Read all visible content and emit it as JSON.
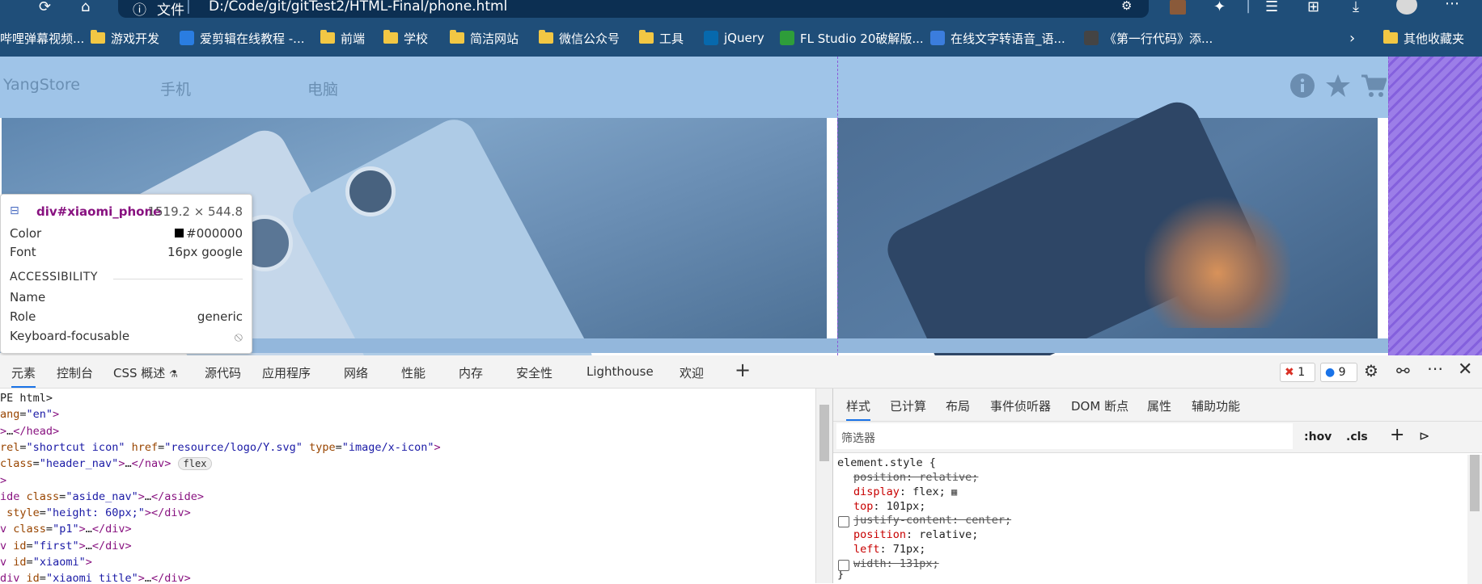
{
  "browser": {
    "address_prefix": "文件",
    "address_path": "D:/Code/git/gitTest2/HTML-Final/phone.html",
    "bookmarks": [
      {
        "label": "哔哩弹幕视频...",
        "kind": "site",
        "color": "#fb7299"
      },
      {
        "label": "游戏开发",
        "kind": "folder"
      },
      {
        "label": "爱剪辑在线教程 -...",
        "kind": "site",
        "color": "#2a7de1"
      },
      {
        "label": "前端",
        "kind": "folder"
      },
      {
        "label": "学校",
        "kind": "folder"
      },
      {
        "label": "简洁网站",
        "kind": "folder"
      },
      {
        "label": "微信公众号",
        "kind": "folder"
      },
      {
        "label": "工具",
        "kind": "folder"
      },
      {
        "label": "jQuery",
        "kind": "site",
        "color": "#0769ad"
      },
      {
        "label": "FL Studio 20破解版...",
        "kind": "site",
        "color": "#2e9d3a"
      },
      {
        "label": "在线文字转语音_语...",
        "kind": "site",
        "color": "#3b7ddd"
      },
      {
        "label": "《第一行代码》添...",
        "kind": "site",
        "color": "#444444"
      }
    ],
    "bookmarks_other": "其他收藏夹"
  },
  "page": {
    "brand": "YangStore",
    "nav_items": [
      "手机",
      "电脑"
    ],
    "header_icons": [
      "info-icon",
      "star-icon",
      "cart-icon",
      "user-icon"
    ]
  },
  "inspect_tooltip": {
    "selector": "div#xiaomi_phone",
    "size": "1519.2 × 544.8",
    "color_label": "Color",
    "color_value": "#000000",
    "font_label": "Font",
    "font_value": "16px google",
    "section": "ACCESSIBILITY",
    "name_label": "Name",
    "role_label": "Role",
    "role_value": "generic",
    "focus_label": "Keyboard-focusable"
  },
  "devtools": {
    "tabs": [
      "元素",
      "控制台",
      "CSS 概述",
      "源代码",
      "应用程序",
      "网络",
      "性能",
      "内存",
      "安全性",
      "Lighthouse",
      "欢迎"
    ],
    "errors": "1",
    "messages": "9",
    "code_lines": [
      {
        "html": "<span class='plain'>PE html&gt;</span>"
      },
      {
        "html": "<span class='attr'>ang</span><span class='plain'>=</span><span class='aval'>\"en\"</span><span class='tag'>&gt;</span>"
      },
      {
        "html": "<span class='tag'>&gt;</span><span class='plain'>…</span><span class='tag'>&lt;/head&gt;</span>"
      },
      {
        "html": "<span class='attr'>rel</span><span class='plain'>=</span><span class='aval'>\"shortcut icon\"</span> <span class='attr'>href</span><span class='plain'>=</span><span class='aval'>\"resource/logo/Y.svg\"</span> <span class='attr'>type</span><span class='plain'>=</span><span class='aval'>\"image/x-icon\"</span><span class='tag'>&gt;</span>"
      },
      {
        "html": "<span class='attr'>class</span><span class='plain'>=</span><span class='aval'>\"header_nav\"</span><span class='tag'>&gt;</span><span class='plain'>…</span><span class='tag'>&lt;/nav&gt;</span> <span class='badge'>flex</span>"
      },
      {
        "html": "<span class='tag'>&gt;</span>"
      },
      {
        "html": "<span class='tag'>ide</span> <span class='attr'>class</span><span class='plain'>=</span><span class='aval'>\"aside_nav\"</span><span class='tag'>&gt;</span><span class='plain'>…</span><span class='tag'>&lt;/aside&gt;</span>"
      },
      {
        "html": " <span class='attr'>style</span><span class='plain'>=</span><span class='aval'>\"height: 60px;\"</span><span class='tag'>&gt;&lt;/div&gt;</span>"
      },
      {
        "html": "<span class='tag'>v</span> <span class='attr'>class</span><span class='plain'>=</span><span class='aval'>\"p1\"</span><span class='tag'>&gt;</span><span class='plain'>…</span><span class='tag'>&lt;/div&gt;</span>"
      },
      {
        "html": "<span class='tag'>v</span> <span class='attr'>id</span><span class='plain'>=</span><span class='aval'>\"first\"</span><span class='tag'>&gt;</span><span class='plain'>…</span><span class='tag'>&lt;/div&gt;</span>"
      },
      {
        "html": "<span class='tag'>v</span> <span class='attr'>id</span><span class='plain'>=</span><span class='aval'>\"xiaomi\"</span><span class='tag'>&gt;</span>"
      },
      {
        "html": "<span class='tag'>div</span> <span class='attr'>id</span><span class='plain'>=</span><span class='aval'>\"xiaomi_title\"</span><span class='tag'>&gt;</span><span class='plain'>…</span><span class='tag'>&lt;/div&gt;</span>"
      }
    ]
  },
  "styles_panel": {
    "tabs": [
      "样式",
      "已计算",
      "布局",
      "事件侦听器",
      "DOM 断点",
      "属性",
      "辅助功能"
    ],
    "filter_placeholder": "筛选器",
    "hov": ":hov",
    "cls": ".cls",
    "selector": "element.style {",
    "rules": [
      {
        "prop": "position",
        "value": "relative;",
        "struck": true,
        "checkbox": false
      },
      {
        "prop": "display",
        "value": "flex;",
        "struck": false,
        "checkbox": false
      },
      {
        "prop": "top",
        "value": "101px;",
        "struck": false,
        "checkbox": false
      },
      {
        "prop": "justify-content",
        "value": "center;",
        "struck": true,
        "checkbox": true
      },
      {
        "prop": "position",
        "value": "relative;",
        "struck": false,
        "checkbox": false
      },
      {
        "prop": "left",
        "value": "71px;",
        "struck": false,
        "checkbox": false
      },
      {
        "prop": "width",
        "value": "131px;",
        "struck": true,
        "checkbox": true
      }
    ],
    "closing": "}"
  }
}
